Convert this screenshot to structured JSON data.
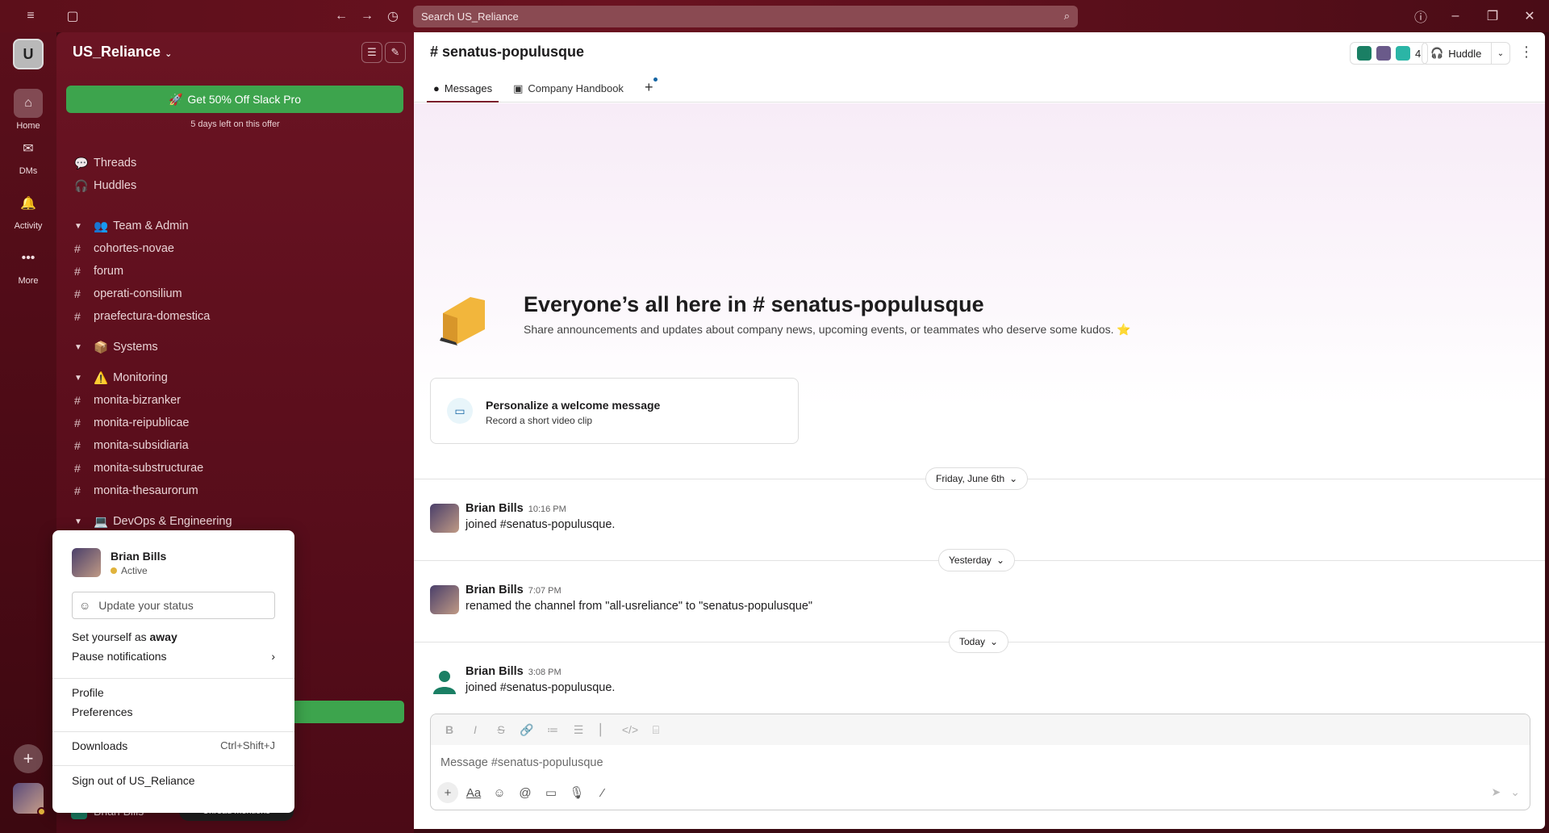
{
  "titlebar": {
    "search_placeholder": "Search US_Reliance"
  },
  "rail": {
    "workspace_initial": "U",
    "items": [
      {
        "label": "Home"
      },
      {
        "label": "DMs"
      },
      {
        "label": "Activity"
      },
      {
        "label": "More"
      }
    ]
  },
  "sidebar": {
    "workspace_name": "US_Reliance",
    "promo_label": "Get 50% Off Slack Pro",
    "promo_sub": "5 days left on this offer",
    "threads": "Threads",
    "huddles": "Huddles",
    "sections": {
      "team_admin": "Team & Admin",
      "systems": "Systems",
      "monitoring": "Monitoring",
      "devops": "DevOps & Engineering"
    },
    "team_channels": [
      "cohortes-novae",
      "forum",
      "operati-consilium",
      "praefectura-domestica"
    ],
    "monitoring_channels": [
      "monita-bizranker",
      "monita-reipublicae",
      "monita-subsidiaria",
      "monita-substructurae",
      "monita-thesaurorum"
    ],
    "bottom_user": "Brian Bills",
    "unread_pill": "Unread mentions"
  },
  "channel": {
    "title": "senatus-populusque",
    "tabs": {
      "messages": "Messages",
      "handbook": "Company Handbook"
    },
    "member_count": "4",
    "huddle_label": "Huddle",
    "hero_title": "Everyone’s all here in # senatus-populusque",
    "hero_sub": "Share announcements and updates about company news, upcoming events, or teammates who deserve some kudos. ⭐",
    "welcome_title": "Personalize a welcome message",
    "welcome_sub": "Record a short video clip",
    "dates": [
      "Friday, June 6th",
      "Yesterday",
      "Today"
    ],
    "messages": [
      {
        "name": "Brian Bills",
        "time": "10:16 PM",
        "text": "joined #senatus-populusque."
      },
      {
        "name": "Brian Bills",
        "time": "7:07 PM",
        "text": "renamed the channel from \"all-usreliance\" to \"senatus-populusque\""
      },
      {
        "name": "Brian Bills",
        "time": "3:08 PM",
        "text": "joined #senatus-populusque."
      }
    ],
    "composer_placeholder": "Message #senatus-populusque"
  },
  "popup": {
    "name": "Brian Bills",
    "status": "Active",
    "status_input": "Update your status",
    "away_prefix": "Set yourself as",
    "away_word": "away",
    "pause": "Pause notifications",
    "profile": "Profile",
    "preferences": "Preferences",
    "downloads": "Downloads",
    "downloads_shortcut": "Ctrl+Shift+J",
    "signout": "Sign out of US_Reliance"
  },
  "colors": {
    "accent": "#6b1423",
    "promo": "#3da44d",
    "status": "#e0b33c"
  }
}
